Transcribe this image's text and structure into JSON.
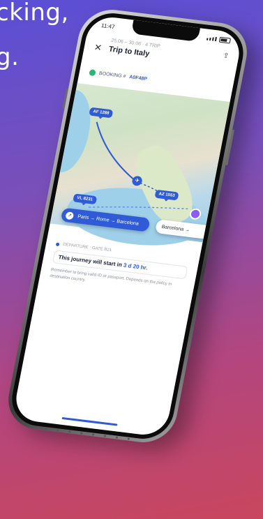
{
  "headline": {
    "line1": "cking,",
    "line2": "g."
  },
  "statusbar": {
    "time": "11:47"
  },
  "trip": {
    "subtitle": "25.06 – 30.06 · 4 TRIP",
    "title": "Trip to Italy",
    "code_prefix": "BOOKING #",
    "code": "A0F48P"
  },
  "map": {
    "pins": [
      {
        "label": "AF 1288"
      },
      {
        "label": "AZ 1553"
      },
      {
        "label": "VL 8231"
      }
    ],
    "route_chip": {
      "label": "Paris → Rome → Barcelona"
    },
    "city_chip": {
      "label": "Barcelona →"
    }
  },
  "info": {
    "label": "DEPARTURE · GATE B21",
    "text_prefix": "This journey will start in ",
    "text_highlight": "3 d 20 hr.",
    "note": "Remember to bring valid ID or passport. Depends on the policy in destination country."
  },
  "colors": {
    "accent": "#2f5bd6",
    "bg_top": "#5a4fd6",
    "bg_bottom": "#c9465e"
  }
}
